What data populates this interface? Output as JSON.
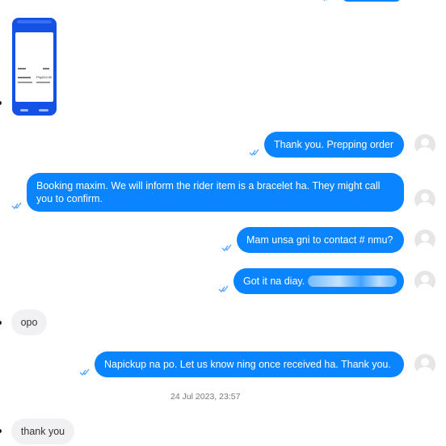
{
  "colors": {
    "outgoing_bubble": "#0a84ff",
    "incoming_bubble": "#f1f1f3",
    "read_check": "#4da3ff"
  },
  "attachment": {
    "name": "phone-screenshot-attachment",
    "text": "Php510.00"
  },
  "messages": [
    {
      "id": "m1",
      "direction": "outgoing",
      "text": "Thank you. Prepping order"
    },
    {
      "id": "m2",
      "direction": "outgoing",
      "text": "Booking maxim. We will inform the rider item is a bracelet ha. They might call you to confirm."
    },
    {
      "id": "m3",
      "direction": "outgoing",
      "text": "Mam unsa gni to contact # nmu?"
    },
    {
      "id": "m4",
      "direction": "outgoing",
      "text": "Got it na diay. "
    },
    {
      "id": "m5",
      "direction": "incoming",
      "text": "opo"
    },
    {
      "id": "m6",
      "direction": "outgoing",
      "text": "Napickup na po. Let us know ning once received ha. Thank you."
    },
    {
      "id": "m7",
      "direction": "incoming",
      "text": "thank you"
    }
  ],
  "timestamp": "24 Jul 2023, 23:57",
  "icons": {
    "avatar": "user-avatar-icon",
    "read": "double-check-icon"
  }
}
